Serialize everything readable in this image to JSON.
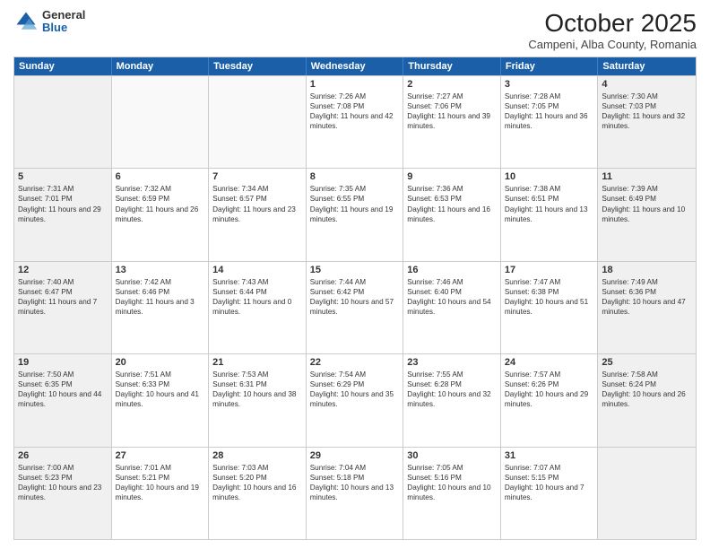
{
  "logo": {
    "general": "General",
    "blue": "Blue"
  },
  "title": "October 2025",
  "subtitle": "Campeni, Alba County, Romania",
  "days": [
    "Sunday",
    "Monday",
    "Tuesday",
    "Wednesday",
    "Thursday",
    "Friday",
    "Saturday"
  ],
  "weeks": [
    [
      {
        "day": "",
        "content": ""
      },
      {
        "day": "",
        "content": ""
      },
      {
        "day": "",
        "content": ""
      },
      {
        "day": "1",
        "content": "Sunrise: 7:26 AM\nSunset: 7:08 PM\nDaylight: 11 hours and 42 minutes."
      },
      {
        "day": "2",
        "content": "Sunrise: 7:27 AM\nSunset: 7:06 PM\nDaylight: 11 hours and 39 minutes."
      },
      {
        "day": "3",
        "content": "Sunrise: 7:28 AM\nSunset: 7:05 PM\nDaylight: 11 hours and 36 minutes."
      },
      {
        "day": "4",
        "content": "Sunrise: 7:30 AM\nSunset: 7:03 PM\nDaylight: 11 hours and 32 minutes."
      }
    ],
    [
      {
        "day": "5",
        "content": "Sunrise: 7:31 AM\nSunset: 7:01 PM\nDaylight: 11 hours and 29 minutes."
      },
      {
        "day": "6",
        "content": "Sunrise: 7:32 AM\nSunset: 6:59 PM\nDaylight: 11 hours and 26 minutes."
      },
      {
        "day": "7",
        "content": "Sunrise: 7:34 AM\nSunset: 6:57 PM\nDaylight: 11 hours and 23 minutes."
      },
      {
        "day": "8",
        "content": "Sunrise: 7:35 AM\nSunset: 6:55 PM\nDaylight: 11 hours and 19 minutes."
      },
      {
        "day": "9",
        "content": "Sunrise: 7:36 AM\nSunset: 6:53 PM\nDaylight: 11 hours and 16 minutes."
      },
      {
        "day": "10",
        "content": "Sunrise: 7:38 AM\nSunset: 6:51 PM\nDaylight: 11 hours and 13 minutes."
      },
      {
        "day": "11",
        "content": "Sunrise: 7:39 AM\nSunset: 6:49 PM\nDaylight: 11 hours and 10 minutes."
      }
    ],
    [
      {
        "day": "12",
        "content": "Sunrise: 7:40 AM\nSunset: 6:47 PM\nDaylight: 11 hours and 7 minutes."
      },
      {
        "day": "13",
        "content": "Sunrise: 7:42 AM\nSunset: 6:46 PM\nDaylight: 11 hours and 3 minutes."
      },
      {
        "day": "14",
        "content": "Sunrise: 7:43 AM\nSunset: 6:44 PM\nDaylight: 11 hours and 0 minutes."
      },
      {
        "day": "15",
        "content": "Sunrise: 7:44 AM\nSunset: 6:42 PM\nDaylight: 10 hours and 57 minutes."
      },
      {
        "day": "16",
        "content": "Sunrise: 7:46 AM\nSunset: 6:40 PM\nDaylight: 10 hours and 54 minutes."
      },
      {
        "day": "17",
        "content": "Sunrise: 7:47 AM\nSunset: 6:38 PM\nDaylight: 10 hours and 51 minutes."
      },
      {
        "day": "18",
        "content": "Sunrise: 7:49 AM\nSunset: 6:36 PM\nDaylight: 10 hours and 47 minutes."
      }
    ],
    [
      {
        "day": "19",
        "content": "Sunrise: 7:50 AM\nSunset: 6:35 PM\nDaylight: 10 hours and 44 minutes."
      },
      {
        "day": "20",
        "content": "Sunrise: 7:51 AM\nSunset: 6:33 PM\nDaylight: 10 hours and 41 minutes."
      },
      {
        "day": "21",
        "content": "Sunrise: 7:53 AM\nSunset: 6:31 PM\nDaylight: 10 hours and 38 minutes."
      },
      {
        "day": "22",
        "content": "Sunrise: 7:54 AM\nSunset: 6:29 PM\nDaylight: 10 hours and 35 minutes."
      },
      {
        "day": "23",
        "content": "Sunrise: 7:55 AM\nSunset: 6:28 PM\nDaylight: 10 hours and 32 minutes."
      },
      {
        "day": "24",
        "content": "Sunrise: 7:57 AM\nSunset: 6:26 PM\nDaylight: 10 hours and 29 minutes."
      },
      {
        "day": "25",
        "content": "Sunrise: 7:58 AM\nSunset: 6:24 PM\nDaylight: 10 hours and 26 minutes."
      }
    ],
    [
      {
        "day": "26",
        "content": "Sunrise: 7:00 AM\nSunset: 5:23 PM\nDaylight: 10 hours and 23 minutes."
      },
      {
        "day": "27",
        "content": "Sunrise: 7:01 AM\nSunset: 5:21 PM\nDaylight: 10 hours and 19 minutes."
      },
      {
        "day": "28",
        "content": "Sunrise: 7:03 AM\nSunset: 5:20 PM\nDaylight: 10 hours and 16 minutes."
      },
      {
        "day": "29",
        "content": "Sunrise: 7:04 AM\nSunset: 5:18 PM\nDaylight: 10 hours and 13 minutes."
      },
      {
        "day": "30",
        "content": "Sunrise: 7:05 AM\nSunset: 5:16 PM\nDaylight: 10 hours and 10 minutes."
      },
      {
        "day": "31",
        "content": "Sunrise: 7:07 AM\nSunset: 5:15 PM\nDaylight: 10 hours and 7 minutes."
      },
      {
        "day": "",
        "content": ""
      }
    ]
  ]
}
